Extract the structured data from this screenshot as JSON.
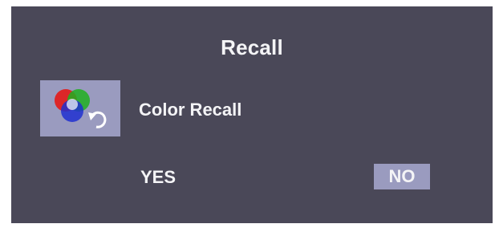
{
  "osd": {
    "title": "Recall",
    "item": {
      "label": "Color Recall",
      "icon": "color-recall-icon"
    },
    "options": {
      "yes": "YES",
      "no": "NO",
      "selected": "NO"
    }
  },
  "colors": {
    "panel_bg": "#4a4858",
    "highlight": "#9a9bbf",
    "text": "#f4f4f6"
  }
}
